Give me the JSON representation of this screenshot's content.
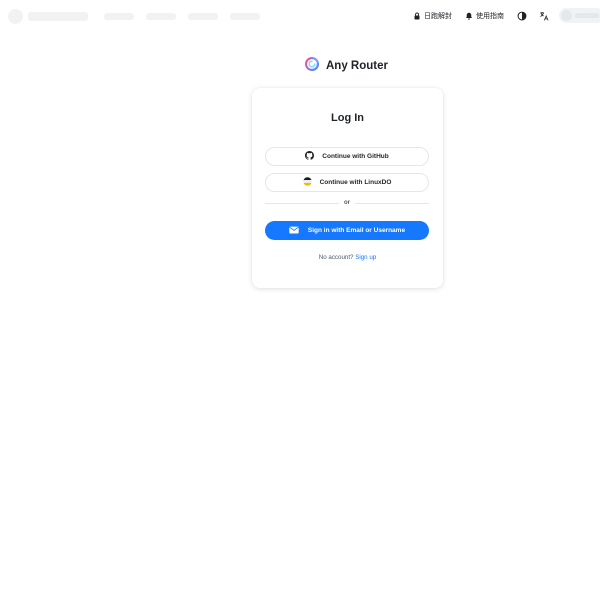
{
  "header": {
    "restore_label": "日跑解封",
    "guide_label": "使用指南"
  },
  "brand": {
    "name": "Any Router",
    "colors": {
      "logo_a": "#ff4d8f",
      "logo_b": "#5b8cff"
    }
  },
  "login": {
    "title": "Log In",
    "github_label": "Continue with GitHub",
    "linuxdo_label": "Continue with LinuxDO",
    "divider_label": "or",
    "email_label": "Sign in with Email or Username",
    "no_account_label": "No account?",
    "signup_label": "Sign up"
  },
  "colors": {
    "primary": "#1677ff",
    "text": "#1f2329",
    "muted": "#4e5969",
    "border": "#e5e6eb"
  },
  "icons": [
    "lock-icon",
    "bell-icon",
    "theme-toggle-icon",
    "translate-icon",
    "github-icon",
    "linuxdo-icon",
    "mail-icon",
    "brand-logo-icon"
  ]
}
